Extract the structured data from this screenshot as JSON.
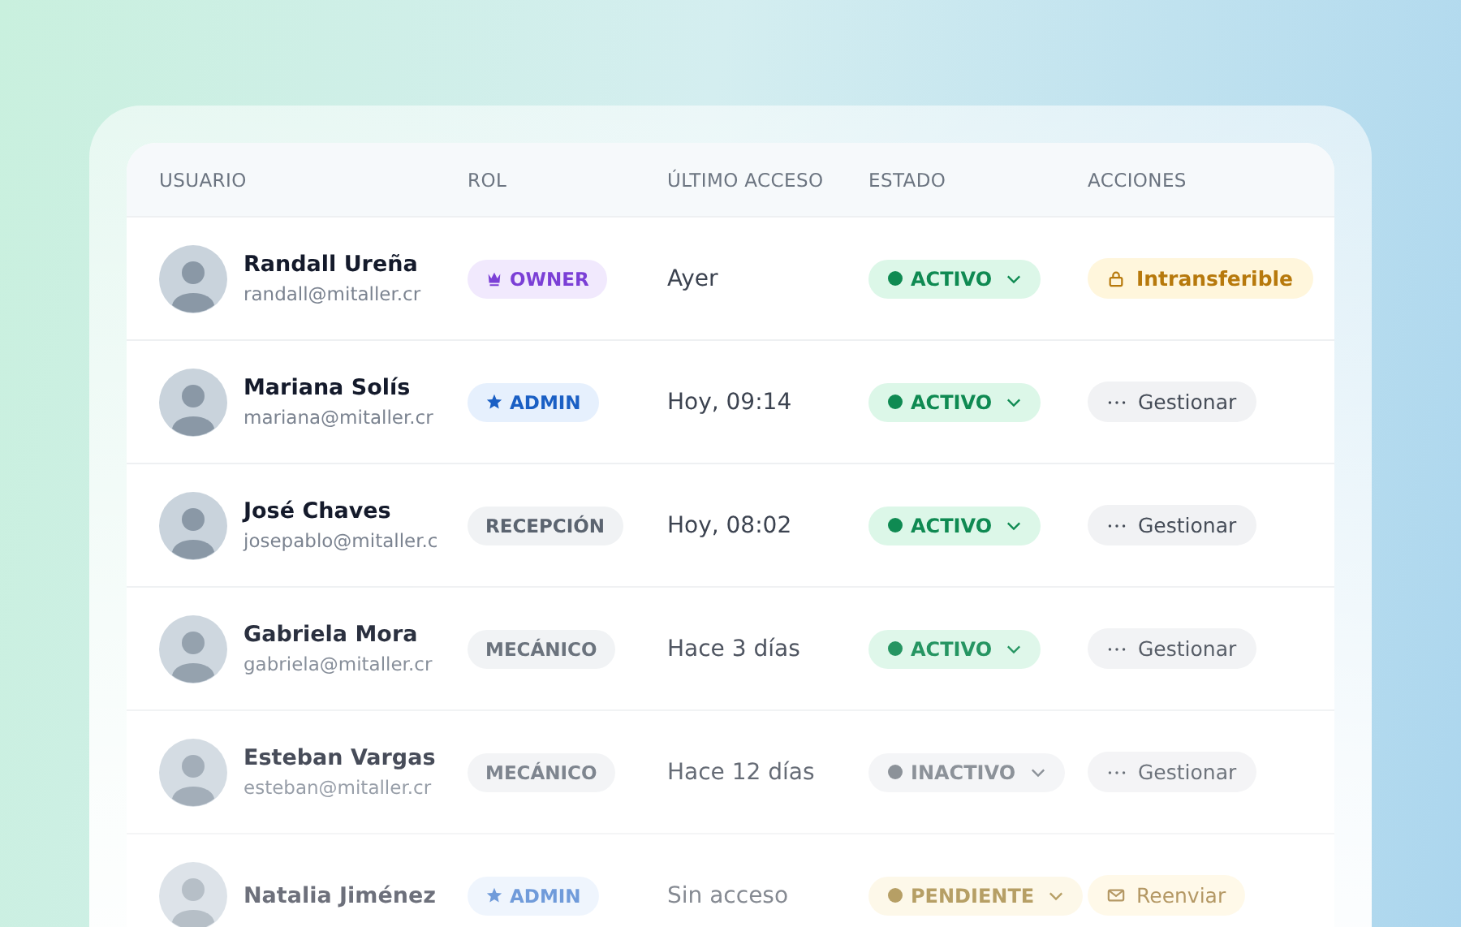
{
  "table": {
    "columns": [
      "USUARIO",
      "ROL",
      "ÚLTIMO ACCESO",
      "ESTADO",
      "ACCIONES"
    ],
    "rows": [
      {
        "name": "Randall Ureña",
        "email": "randall@mitaller.cr",
        "role": {
          "label": "OWNER",
          "kind": "owner"
        },
        "last_access": "Ayer",
        "status": {
          "label": "ACTIVO",
          "kind": "active"
        },
        "action": {
          "label": "Intransferible",
          "kind": "locked"
        }
      },
      {
        "name": "Mariana Solís",
        "email": "mariana@mitaller.cr",
        "role": {
          "label": "ADMIN",
          "kind": "admin"
        },
        "last_access": "Hoy, 09:14",
        "status": {
          "label": "ACTIVO",
          "kind": "active"
        },
        "action": {
          "label": "Gestionar",
          "kind": "manage"
        }
      },
      {
        "name": "José Chaves",
        "email": "josepablo@mitaller.c",
        "role": {
          "label": "RECEPCIÓN",
          "kind": "plain"
        },
        "last_access": "Hoy, 08:02",
        "status": {
          "label": "ACTIVO",
          "kind": "active"
        },
        "action": {
          "label": "Gestionar",
          "kind": "manage"
        }
      },
      {
        "name": "Gabriela Mora",
        "email": "gabriela@mitaller.cr",
        "role": {
          "label": "MECÁNICO",
          "kind": "plain"
        },
        "last_access": "Hace 3 días",
        "status": {
          "label": "ACTIVO",
          "kind": "active"
        },
        "action": {
          "label": "Gestionar",
          "kind": "manage"
        }
      },
      {
        "name": "Esteban Vargas",
        "email": "esteban@mitaller.cr",
        "role": {
          "label": "MECÁNICO",
          "kind": "plain"
        },
        "last_access": "Hace 12 días",
        "status": {
          "label": "INACTIVO",
          "kind": "inactive"
        },
        "action": {
          "label": "Gestionar",
          "kind": "manage"
        }
      },
      {
        "name": "Natalia Jiménez",
        "role": {
          "label": "ADMIN",
          "kind": "admin"
        },
        "last_access": "Sin acceso",
        "status": {
          "label": "PENDIENTE",
          "kind": "pending"
        },
        "action": {
          "label": "Reenviar",
          "kind": "resend"
        }
      }
    ]
  }
}
